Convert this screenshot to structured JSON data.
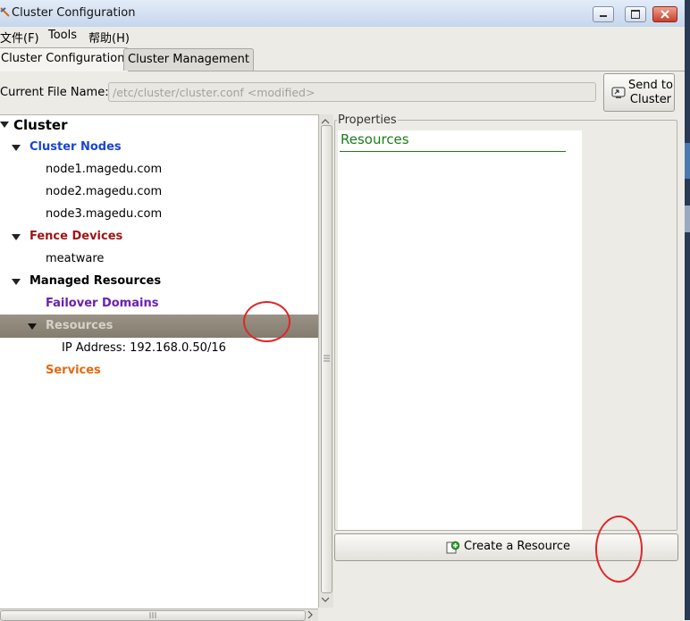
{
  "window": {
    "title": "Cluster Configuration"
  },
  "menu": {
    "items": [
      "文件(F)",
      "Tools",
      "帮助(H)"
    ]
  },
  "tabs": [
    {
      "label": "Cluster Configuration",
      "active": true
    },
    {
      "label": "Cluster Management",
      "active": false
    }
  ],
  "file": {
    "label": "Current File Name:",
    "value": "/etc/cluster/cluster.conf <modified>"
  },
  "send_button": {
    "line1": "Send to",
    "line2": "Cluster",
    "icon": "send-icon"
  },
  "tree": {
    "root": "Cluster",
    "cluster_nodes": {
      "label": "Cluster Nodes",
      "color": "#1a44d8"
    },
    "nodes": [
      "node1.magedu.com",
      "node2.magedu.com",
      "node3.magedu.com"
    ],
    "fence_devices": {
      "label": "Fence Devices",
      "color": "#a01515"
    },
    "fence_items": [
      "meatware"
    ],
    "managed_resources": {
      "label": "Managed Resources"
    },
    "failover_domains": {
      "label": "Failover Domains",
      "color": "#6b1fb0"
    },
    "resources": {
      "label": "Resources",
      "selected": true
    },
    "resource_items": [
      {
        "key": "IP Address:",
        "value": "192.168.0.50/16"
      }
    ],
    "services": {
      "label": "Services",
      "color": "#e06a10"
    }
  },
  "properties": {
    "legend": "Properties",
    "heading": "Resources",
    "heading_color": "#1b7d1b"
  },
  "create_button": {
    "label": "Create a Resource",
    "icon": "add-resource-icon"
  },
  "annotation_color": "#e0262a"
}
